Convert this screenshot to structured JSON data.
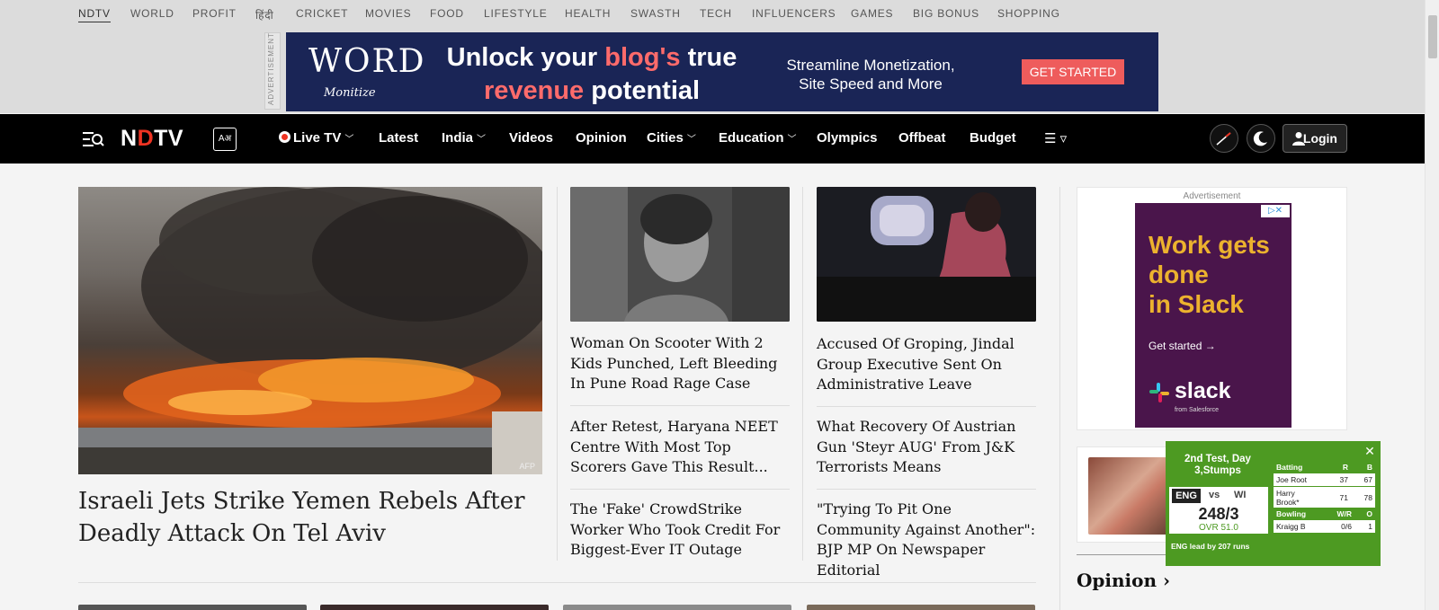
{
  "top_nav": [
    "NDTV",
    "WORLD",
    "PROFIT",
    "हिंदी",
    "CRICKET",
    "MOVIES",
    "FOOD",
    "LIFESTYLE",
    "HEALTH",
    "SWASTH",
    "TECH",
    "INFLUENCERS",
    "GAMES",
    "BIG BONUS",
    "SHOPPING"
  ],
  "ad_banner": {
    "side_label": "ADVERTISEMENT",
    "logo_top": "WORD",
    "logo_bottom": "Monitize",
    "headline_1": "Unlock your ",
    "headline_hl1": "blog's",
    "headline_2": " true",
    "headline_hl2": "revenue",
    "headline_3": " potential",
    "sub_line_1": "Streamline Monetization,",
    "sub_line_2": "Site Speed and More",
    "cta": "GET STARTED"
  },
  "header": {
    "brand_a": "N",
    "brand_dot": "D",
    "brand_b": "TV",
    "lang_glyph": "Aअ",
    "nav": [
      {
        "label": "Live TV",
        "dropdown": true,
        "live": true
      },
      {
        "label": "Latest",
        "dropdown": false
      },
      {
        "label": "India",
        "dropdown": true
      },
      {
        "label": "Videos",
        "dropdown": false
      },
      {
        "label": "Opinion",
        "dropdown": false
      },
      {
        "label": "Cities",
        "dropdown": true
      },
      {
        "label": "Education",
        "dropdown": true
      },
      {
        "label": "Olympics",
        "dropdown": false
      },
      {
        "label": "Offbeat",
        "dropdown": false
      },
      {
        "label": "Budget",
        "dropdown": false
      }
    ],
    "more_icon": "☰ ▿",
    "login": "Login"
  },
  "lead_story": {
    "title": "Israeli Jets Strike Yemen Rebels After Deadly Attack On Tel Aviv",
    "image_credit": "AFP"
  },
  "col2_stories": [
    "Woman On Scooter With 2 Kids Punched, Left Bleeding In Pune Road Rage Case",
    "After Retest, Haryana NEET Centre With Most Top Scorers Gave This Result...",
    "The 'Fake' CrowdStrike Worker Who Took Credit For Biggest-Ever IT Outage"
  ],
  "col3_stories": [
    "Accused Of Groping, Jindal Group Executive Sent On Administrative Leave",
    "What Recovery Of Austrian Gun 'Steyr AUG' From J&K Terrorists Means",
    "\"Trying To Pit One Community Against Another\": BJP MP On Newspaper Editorial"
  ],
  "right_ad": {
    "label": "Advertisement",
    "headline_lines": [
      "Work gets",
      "done",
      "in Slack"
    ],
    "cta": "Get started →",
    "brand": "slack",
    "from": "from Salesforce"
  },
  "opinion_heading": "Opinion ›",
  "cricket": {
    "title": "2nd Test, Day 3,Stumps",
    "team1": "ENG",
    "vs": "vs",
    "team2": "WI",
    "score": "248/3",
    "overs": "OVR 51.0",
    "lead_note": "ENG lead by 207 runs",
    "batting_header": [
      "Batting",
      "R",
      "B"
    ],
    "batting": [
      {
        "name": "Joe Root",
        "r": "37",
        "b": "67"
      },
      {
        "name": "Harry Brook*",
        "r": "71",
        "b": "78"
      }
    ],
    "bowling_header": [
      "Bowling",
      "W/R",
      "O"
    ],
    "bowling": [
      {
        "name": "Kraigg B",
        "wr": "0/6",
        "o": "1"
      }
    ],
    "close": "✕"
  },
  "colors": {
    "header_bg": "#000000",
    "brand_red": "#e33322",
    "banner_bg": "#1a2556",
    "cta_red": "#ee5c5c",
    "slack_purple": "#4a154b",
    "cricket_green": "#4d9a22"
  }
}
